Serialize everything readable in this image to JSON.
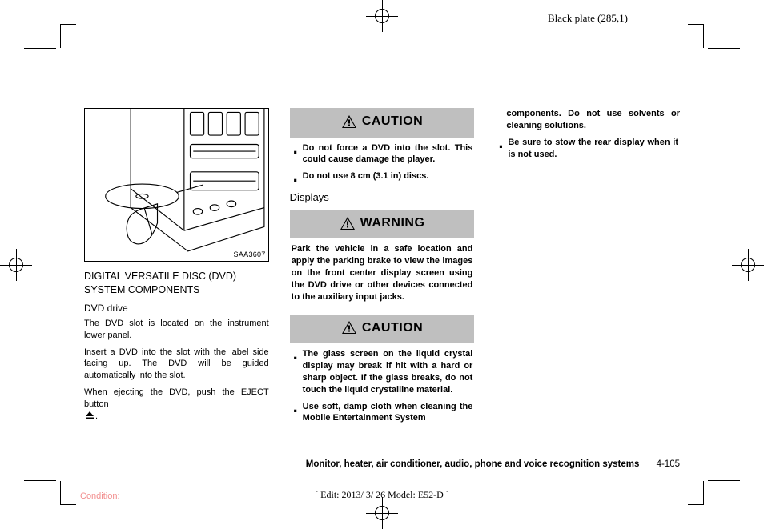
{
  "meta": {
    "topLabel": "Black plate (285,1)",
    "condition": "Condition:",
    "editLine": "[ Edit: 2013/ 3/ 26   Model:  E52-D ]"
  },
  "figure": {
    "code": "SAA3607"
  },
  "col1": {
    "heading": "DIGITAL VERSATILE DISC (DVD) SYSTEM COMPONENTS",
    "sub": "DVD drive",
    "p1": "The DVD slot is located on the instrument lower panel.",
    "p2": "Insert a DVD into the slot with the label side facing up. The DVD will be guided automatically into the slot.",
    "p3a": "When ejecting the DVD, push the EJECT button",
    "p3b": "."
  },
  "col2": {
    "caution1Title": "CAUTION",
    "caution1_b1": "Do not force a DVD into the slot. This could cause damage the player.",
    "caution1_b2": "Do not use 8 cm (3.1 in) discs.",
    "displays": "Displays",
    "warningTitle": "WARNING",
    "warningText": "Park the vehicle in a safe location and apply the parking brake to view the images on the front center display screen using the DVD drive or other devices connected to the auxiliary input jacks.",
    "caution2Title": "CAUTION",
    "caution2_b1": "The glass screen on the liquid crystal display may break if hit with a hard or sharp object. If the glass breaks, do not touch the liquid crystalline material.",
    "caution2_b2": "Use soft, damp cloth when cleaning the Mobile Entertainment System"
  },
  "col3": {
    "cont1": "components. Do not use solvents or cleaning solutions.",
    "b2": "Be sure to stow the rear display when it is not used."
  },
  "footer": {
    "section": "Monitor, heater, air conditioner, audio, phone and voice recognition systems",
    "page": "4-105"
  }
}
